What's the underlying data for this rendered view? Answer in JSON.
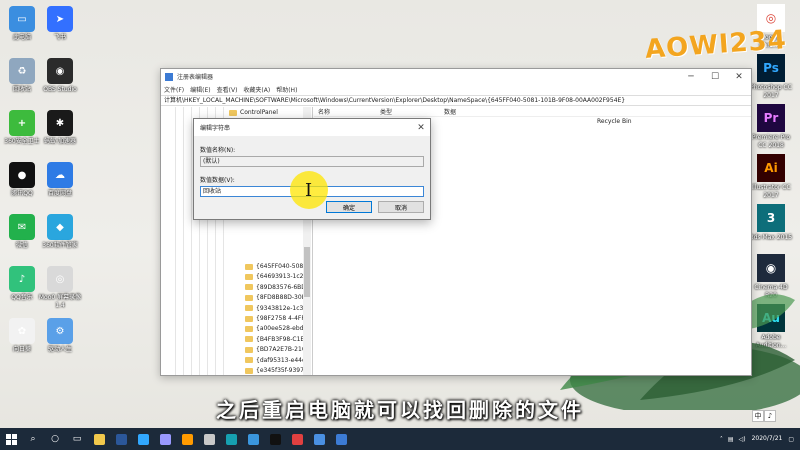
{
  "desktop": {
    "left_icons": [
      {
        "label": "此电脑",
        "color": "#3b8ee0",
        "glyph": "▭"
      },
      {
        "label": "飞书",
        "color": "#3370ff",
        "glyph": "➤"
      },
      {
        "label": "回收站",
        "color": "#8fa7bf",
        "glyph": "♻"
      },
      {
        "label": "OBS Studio",
        "color": "#2b2b2b",
        "glyph": "◉"
      },
      {
        "label": "360安全卫士",
        "color": "#3dbb3d",
        "glyph": "+"
      },
      {
        "label": "蚂蚁·加速器",
        "color": "#1a1a1a",
        "glyph": "✱"
      },
      {
        "label": "腾讯QQ",
        "color": "#111111",
        "glyph": "●"
      },
      {
        "label": "百度网盘",
        "color": "#2e7be5",
        "glyph": "☁"
      },
      {
        "label": "微信",
        "color": "#22b14c",
        "glyph": "✉"
      },
      {
        "label": "360软件管家",
        "color": "#2aa6de",
        "glyph": "◆"
      },
      {
        "label": "QQ音乐",
        "color": "#31c27c",
        "glyph": "♪"
      },
      {
        "label": "Moo0 屏幕录像 1.4",
        "color": "#d9d9d9",
        "glyph": "◎"
      },
      {
        "label": "向日葵",
        "color": "#f2f2f2",
        "glyph": "✿"
      },
      {
        "label": "驱动人生",
        "color": "#5aa0e8",
        "glyph": "⚙"
      }
    ],
    "right_icons": [
      {
        "label": "Google Chrome",
        "color": "#ffffff",
        "fg": "#db4437",
        "glyph": "◎"
      },
      {
        "label": "Photoshop CC 2017",
        "color": "#001d34",
        "fg": "#31a8ff",
        "glyph": "Ps"
      },
      {
        "label": "Premiere Pro CC 2018",
        "color": "#1f0740",
        "fg": "#e77cff",
        "glyph": "Pr"
      },
      {
        "label": "Illustrator CC 2017",
        "color": "#330000",
        "fg": "#ff9a00",
        "glyph": "Ai"
      },
      {
        "label": "3ds Max 2015",
        "color": "#0d6e7a",
        "fg": "#ffffff",
        "glyph": "3"
      },
      {
        "label": "Cinema 4D R20",
        "color": "#1e2a3c",
        "fg": "#ffffff",
        "glyph": "◉"
      },
      {
        "label": "Adobe Audition...",
        "color": "#00343b",
        "fg": "#2ddff2",
        "glyph": "Au"
      }
    ],
    "watermark": "AOWI234"
  },
  "regedit": {
    "title": "注册表编辑器",
    "menu": [
      "文件(F)",
      "编辑(E)",
      "查看(V)",
      "收藏夹(A)",
      "帮助(H)"
    ],
    "address": "计算机\\HKEY_LOCAL_MACHINE\\SOFTWARE\\Microsoft\\Windows\\CurrentVersion\\Explorer\\Desktop\\NameSpace\\{645FF040-5081-101B-9F08-00AA002F954E}",
    "tree_top": [
      "ControlPanel",
      "Desktop"
    ],
    "tree_items": [
      "{645FF040-508",
      "{64693913-1c2",
      "{89D83576-6BD",
      "{8FD8B88D-30E",
      "{9343812e-1c3",
      "{98F2758 4-4FF",
      "{a00ee528-ebd",
      "{B4FB3F98-C1E",
      "{BD7A2E7B-21C",
      "{daf95313-e44c",
      "{e345f35f-9397",
      "{EDC978D6-4D5",
      "{F02C1A0D-BE2",
      "{f8278c54-a712",
      "DelegateFolder"
    ],
    "columns": [
      "名称",
      "类型",
      "数据"
    ],
    "row_data": "Recycle Bin"
  },
  "dialog": {
    "title": "编辑字符串",
    "name_label": "数值名称(N):",
    "name_value": "(默认)",
    "data_label": "数值数据(V):",
    "data_value": "回收站",
    "ok": "确定",
    "cancel": "取消"
  },
  "subtitle": "之后重启电脑就可以找回删除的文件",
  "taskbar": {
    "apps": [
      {
        "name": "explorer",
        "color": "#f2c94c"
      },
      {
        "name": "word",
        "color": "#2b579a"
      },
      {
        "name": "photoshop",
        "color": "#31a8ff"
      },
      {
        "name": "premiere",
        "color": "#9999ff"
      },
      {
        "name": "illustrator",
        "color": "#ff9a00"
      },
      {
        "name": "cinema4d",
        "color": "#c8c8c8"
      },
      {
        "name": "3dsmax",
        "color": "#16a0b0"
      },
      {
        "name": "edge",
        "color": "#3a96dd"
      },
      {
        "name": "qq",
        "color": "#111111"
      },
      {
        "name": "obs",
        "color": "#e04040"
      },
      {
        "name": "app",
        "color": "#4a90e2"
      },
      {
        "name": "regedit",
        "color": "#3c7bd4"
      }
    ],
    "ime": [
      "中",
      "♪"
    ],
    "date": "2020/7/21"
  }
}
